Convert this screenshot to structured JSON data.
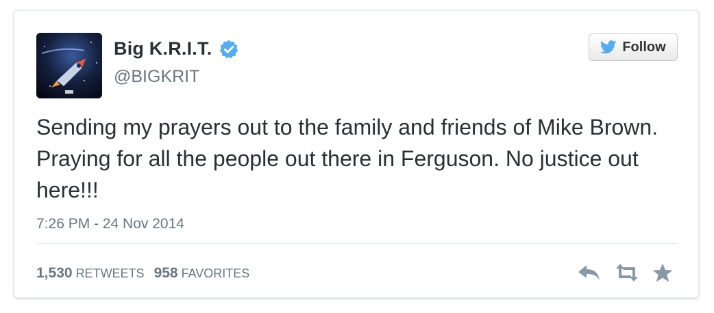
{
  "user": {
    "name": "Big K.R.I.T.",
    "handle": "@BIGKRIT",
    "verified": true
  },
  "follow_button": {
    "label": "Follow",
    "icon": "twitter-bird-icon"
  },
  "tweet": {
    "text": "Sending my prayers out to the family and friends of Mike Brown. Praying for all the people out there in Ferguson. No justice out here!!!",
    "timestamp": "7:26 PM - 24 Nov 2014"
  },
  "stats": {
    "retweets_count": "1,530",
    "retweets_label": "RETWEETS",
    "favorites_count": "958",
    "favorites_label": "FAVORITES"
  },
  "actions": [
    "reply-icon",
    "retweet-icon",
    "favorite-icon"
  ],
  "colors": {
    "text": "#292f33",
    "muted": "#66757f",
    "verified_blue": "#55acee",
    "border": "#e1e8ed",
    "action_icons": "#8899a6"
  }
}
